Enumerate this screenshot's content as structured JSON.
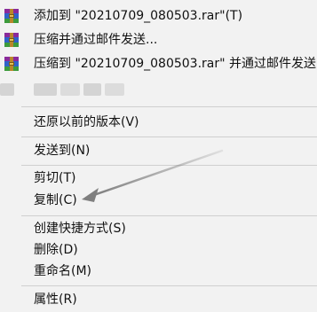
{
  "context_menu": {
    "items": [
      {
        "label": "添加到 \"20210709_080503.rar\"(T)",
        "icon": "winrar-icon"
      },
      {
        "label": "压缩并通过邮件发送...",
        "icon": "winrar-icon"
      },
      {
        "label": "压缩到 \"20210709_080503.rar\" 并通过邮件发送",
        "icon": "winrar-icon"
      },
      {
        "label": "还原以前的版本(V)"
      },
      {
        "label": "发送到(N)"
      },
      {
        "label": "剪切(T)"
      },
      {
        "label": "复制(C)"
      },
      {
        "label": "创建快捷方式(S)"
      },
      {
        "label": "删除(D)"
      },
      {
        "label": "重命名(M)"
      },
      {
        "label": "属性(R)"
      }
    ]
  },
  "annotation": {
    "arrow_color": "#8a8a8a",
    "points_to": "复制(C)"
  }
}
